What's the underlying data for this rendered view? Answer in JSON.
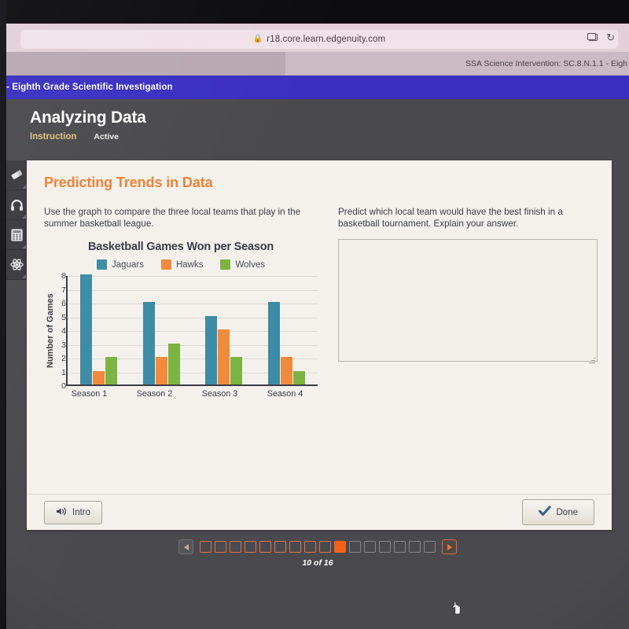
{
  "browser": {
    "url": "r18.core.learn.edgenuity.com",
    "lock_icon": "lock-icon",
    "tab_title": "SSA Science Intervention: SC.8.N.1.1 - Eigh",
    "new_tab_icon": "new-window-icon",
    "reload_icon": "reload-icon",
    "reload_glyph": "↻"
  },
  "course_bar": {
    "title": "- Eighth Grade Scientific Investigation"
  },
  "app": {
    "title": "Analyzing Data",
    "tabs": [
      {
        "label": "Instruction",
        "active": true
      },
      {
        "label": "Active",
        "active": false
      }
    ]
  },
  "tool_rail": {
    "items": [
      {
        "name": "eraser-icon"
      },
      {
        "name": "headphones-icon"
      },
      {
        "name": "calculator-icon"
      },
      {
        "name": "atom-icon"
      }
    ]
  },
  "card": {
    "title": "Predicting Trends in Data",
    "left_prompt": "Use the graph to compare the three local teams that play in the summer basketball league.",
    "right_prompt": "Predict which local team would have the best finish in a basketball tournament. Explain your answer.",
    "answer": {
      "value": "",
      "placeholder": ""
    },
    "intro_button": "Intro",
    "done_button": "Done"
  },
  "pagination": {
    "page_label": "10 of 16",
    "current": 10,
    "total": 16,
    "prev_icon": "prev-arrow-icon",
    "next_icon": "next-arrow-icon"
  },
  "colors": {
    "jaguars": "#3d8ba5",
    "hawks": "#f08a3c",
    "wolves": "#7cb342",
    "accent_orange": "#ee7f33",
    "current_page": "#f4621a",
    "nav_blue": "#3a2fc2"
  },
  "chart_data": {
    "type": "bar",
    "title": "Basketball Games Won per Season",
    "xlabel": "",
    "ylabel": "Number of Games",
    "categories": [
      "Season 1",
      "Season 2",
      "Season 3",
      "Season 4"
    ],
    "series": [
      {
        "name": "Jaguars",
        "color": "#3d8ba5",
        "values": [
          8,
          6,
          5,
          6
        ]
      },
      {
        "name": "Hawks",
        "color": "#f08a3c",
        "values": [
          1,
          2,
          4,
          2
        ]
      },
      {
        "name": "Wolves",
        "color": "#7cb342",
        "values": [
          2,
          3,
          2,
          1
        ]
      }
    ],
    "ylim": [
      0,
      8
    ],
    "yticks": [
      0,
      1,
      2,
      3,
      4,
      5,
      6,
      7,
      8
    ],
    "grid": true,
    "legend_position": "top"
  }
}
